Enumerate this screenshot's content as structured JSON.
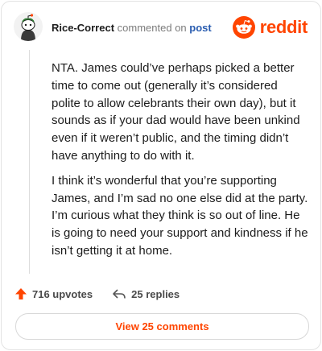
{
  "header": {
    "username": "Rice-Correct",
    "action_text": "commented on",
    "post_link": "post",
    "brand_word": "reddit"
  },
  "comment": {
    "paragraphs": [
      "NTA. James could’ve perhaps picked a better time to come out (generally it’s considered polite to allow celebrants their own day), but it sounds as if your dad would have been unkind even if it weren’t public, and the timing didn’t have anything to do with it.",
      "I think it’s wonderful that you’re supporting James, and I’m sad no one else did at the party. I’m curious what they think is so out of line. He is going to need your support and kindness if he isn’t getting it at home."
    ]
  },
  "actions": {
    "upvotes": "716 upvotes",
    "replies": "25 replies"
  },
  "footer": {
    "view_comments": "View 25 comments"
  },
  "colors": {
    "brand": "#ff4500",
    "link": "#2a5db0"
  },
  "icons": {
    "avatar": "snoo-avatar",
    "logo": "reddit-logo-icon",
    "upvote": "upvote-arrow-icon",
    "reply": "reply-arrow-icon"
  }
}
